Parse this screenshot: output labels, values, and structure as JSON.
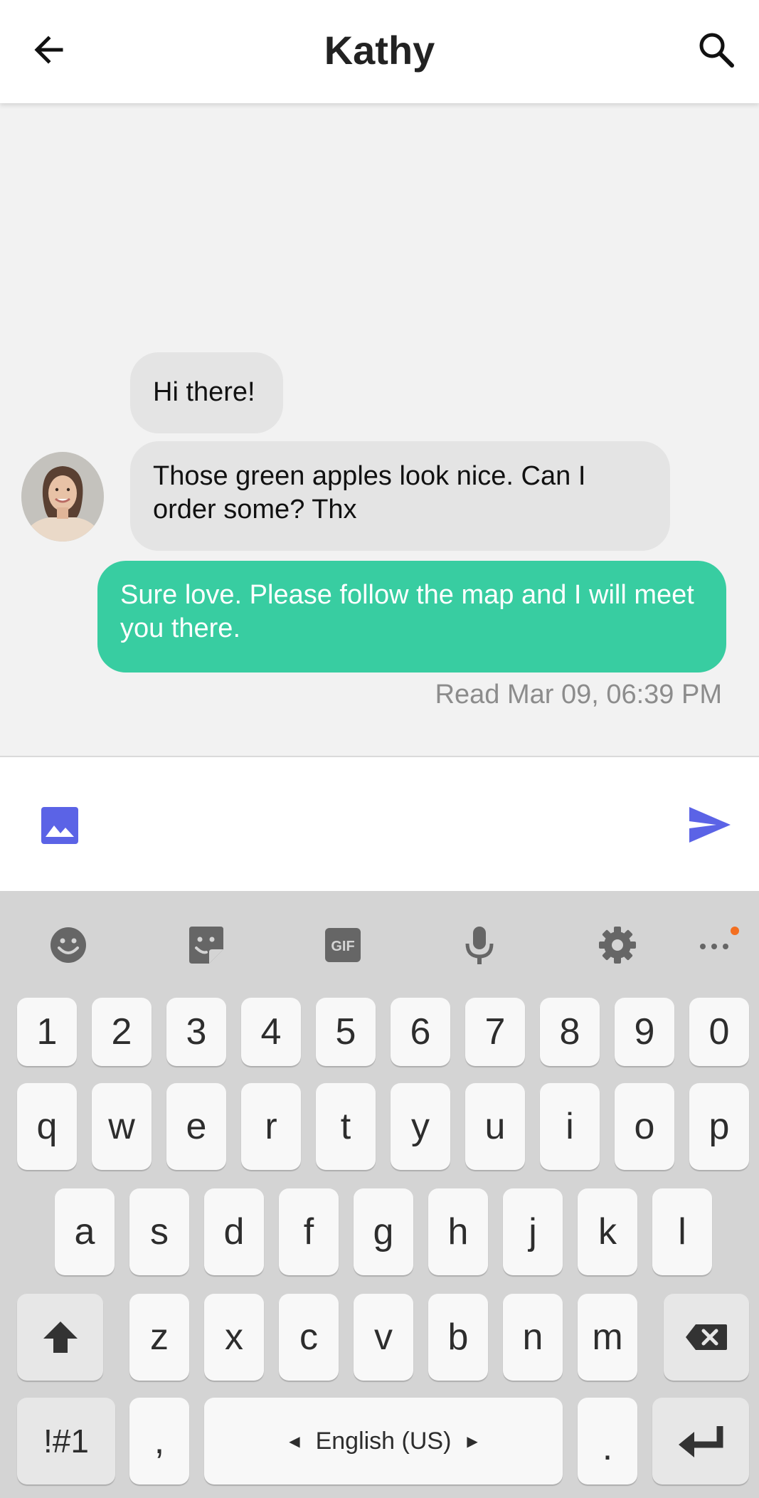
{
  "header": {
    "title": "Kathy"
  },
  "chat": {
    "messages": [
      {
        "text": "Hi there!",
        "direction": "incoming"
      },
      {
        "text": "Those green apples look nice. Can I order some? Thx",
        "direction": "incoming"
      },
      {
        "text": "Sure love. Please follow the map and I will meet you there.",
        "direction": "outgoing"
      }
    ],
    "read_status": "Read Mar 09, 06:39 PM"
  },
  "colors": {
    "accent": "#5b63e6",
    "outgoing_bubble": "#38cda1",
    "incoming_bubble": "#e4e4e4",
    "badge": "#f36f21"
  },
  "keyboard": {
    "toolbar": [
      "emoji-icon",
      "sticker-icon",
      "gif-icon",
      "microphone-icon",
      "settings-icon",
      "more-icon"
    ],
    "row_numbers": [
      "1",
      "2",
      "3",
      "4",
      "5",
      "6",
      "7",
      "8",
      "9",
      "0"
    ],
    "row_1": [
      "q",
      "w",
      "e",
      "r",
      "t",
      "y",
      "u",
      "i",
      "o",
      "p"
    ],
    "row_2": [
      "a",
      "s",
      "d",
      "f",
      "g",
      "h",
      "j",
      "k",
      "l"
    ],
    "row_3": [
      "z",
      "x",
      "c",
      "v",
      "b",
      "n",
      "m"
    ],
    "symbols_label": "!#1",
    "comma_label": ",",
    "space_label": "English (US)",
    "period_label": "."
  }
}
